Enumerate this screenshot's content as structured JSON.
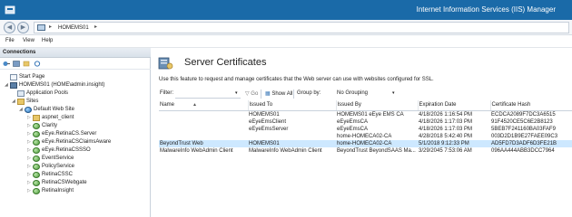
{
  "window": {
    "title": "Internet Information Services (IIS) Manager"
  },
  "address": {
    "crumb": "HOMEMS01",
    "separator": "▸"
  },
  "menu": {
    "items": [
      "File",
      "View",
      "Help"
    ]
  },
  "connections": {
    "header": "Connections",
    "tree": [
      {
        "label": "Start Page",
        "icon": "page-icon",
        "expander": ""
      },
      {
        "label": "HOMEMS01 (HOME\\admin.insight)",
        "icon": "server-icon",
        "expander": "◢"
      },
      {
        "label": "Application Pools",
        "icon": "app-pool-icon",
        "expander": ""
      },
      {
        "label": "Sites",
        "icon": "folder-icon",
        "expander": "◢"
      },
      {
        "label": "Default Web Site",
        "icon": "globe-icon",
        "expander": "◢"
      },
      {
        "label": "aspnet_client",
        "icon": "folder-icon",
        "expander": "▷"
      },
      {
        "label": "Clarity",
        "icon": "application-icon",
        "expander": "▷"
      },
      {
        "label": "eEye.RetinaCS.Server",
        "icon": "application-icon",
        "expander": "▷"
      },
      {
        "label": "eEye.RetinaCSClaimsAware",
        "icon": "application-icon",
        "expander": "▷"
      },
      {
        "label": "eEye.RetinaCSSSO",
        "icon": "application-icon",
        "expander": "▷"
      },
      {
        "label": "EventService",
        "icon": "application-icon",
        "expander": "▷"
      },
      {
        "label": "PolicyService",
        "icon": "application-icon",
        "expander": "▷"
      },
      {
        "label": "RetinaCSSC",
        "icon": "application-icon",
        "expander": "▷"
      },
      {
        "label": "RetinaCSWebgate",
        "icon": "application-icon",
        "expander": "▷"
      },
      {
        "label": "RetinaInsight",
        "icon": "application-icon",
        "expander": "▷"
      }
    ]
  },
  "main": {
    "title": "Server Certificates",
    "description": "Use this feature to request and manage certificates that the Web server can use with websites configured for SSL.",
    "filter": {
      "label": "Filter:",
      "value": "",
      "go_label": "Go",
      "show_all_label": "Show All",
      "group_by_label": "Group by:",
      "group_by_value": "No Grouping"
    },
    "table": {
      "columns": [
        "Name",
        "Issued To",
        "Issued By",
        "Expiration Date",
        "Certificate Hash"
      ],
      "rows": [
        [
          "",
          "HOMEMS01",
          "HOMEMS01 eEye EMS CA",
          "4/18/2026 1:16:54 PM",
          "ECDCA2089F7DC3A6515"
        ],
        [
          "",
          "eEyeEmsClient",
          "eEyeEmsCA",
          "4/18/2026 1:17:03 PM",
          "91F4520CE5C6E2B8123"
        ],
        [
          "",
          "eEyeEmsServer",
          "eEyeEmsCA",
          "4/18/2026 1:17:03 PM",
          "5BEB7F241160BA03FAF9"
        ],
        [
          "",
          "",
          "home-HOMECA02-CA",
          "4/28/2018 5:42:40 PM",
          "003D2D1B9E27FAEE09C3"
        ],
        [
          "BeyondTrust Web",
          "HOMEMS01",
          "home-HOMECA02-CA",
          "5/1/2018 9:12:33 PM",
          "AD5FD7D3ADF6D3FE21B"
        ],
        [
          "MalwareInfo WebAdmin Client",
          "MalwareInfo WebAdmin Client",
          "BeyondTrust BeyondSAAS Ma...",
          "3/29/2045 7:53:06 AM",
          "096AA444ABB3DCC7964"
        ]
      ],
      "selected_row": 4
    }
  },
  "colors": {
    "titlebar": "#1a6aa8",
    "selection": "#cde8ff"
  }
}
